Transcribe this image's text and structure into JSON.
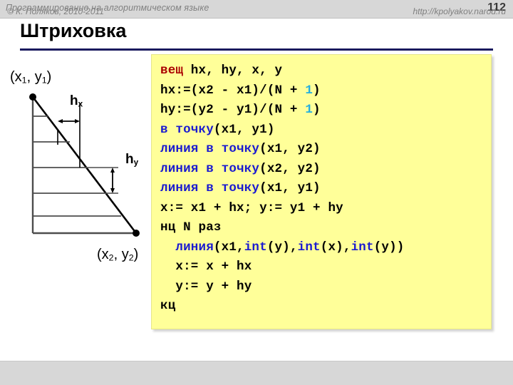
{
  "header": {
    "subject": "Программирование на алгоритмическом языке",
    "page_number": "112"
  },
  "title": "Штриховка",
  "colors": {
    "rule": "#1a1a5e",
    "code_background": "#ffff99",
    "keyword_red": "#aa0000",
    "keyword_blue": "#1a1ad0",
    "number_cyan": "#22aee0",
    "header_background": "#d7d7d7"
  },
  "diagram": {
    "point_top_label": "(x1, y1)",
    "point_top_base": "(x",
    "point_top_sub1": "1",
    "point_top_mid": ", y",
    "point_top_sub2": "1",
    "point_top_end": ")",
    "point_bottom_base": "(x",
    "point_bottom_sub1": "2",
    "point_bottom_mid": ", y",
    "point_bottom_sub2": "2",
    "point_bottom_end": ")",
    "point_bottom_label": "(x2, y2)",
    "hx_base": "h",
    "hx_sub": "x",
    "hy_base": "h",
    "hy_sub": "y"
  },
  "code": {
    "lines": [
      [
        {
          "t": "вещ",
          "c": "red"
        },
        {
          "t": " hx, hy, x, y",
          "c": "plain"
        }
      ],
      [
        {
          "t": "hx:=(x2 - x1)/(N + ",
          "c": "plain"
        },
        {
          "t": "1",
          "c": "cyan"
        },
        {
          "t": ")",
          "c": "plain"
        }
      ],
      [
        {
          "t": "hy:=(y2 - y1)/(N + ",
          "c": "plain"
        },
        {
          "t": "1",
          "c": "cyan"
        },
        {
          "t": ")",
          "c": "plain"
        }
      ],
      [
        {
          "t": "в точку",
          "c": "blue"
        },
        {
          "t": "(x1, y1)",
          "c": "plain"
        }
      ],
      [
        {
          "t": "линия в точку",
          "c": "blue"
        },
        {
          "t": "(x1, y2)",
          "c": "plain"
        }
      ],
      [
        {
          "t": "линия в точку",
          "c": "blue"
        },
        {
          "t": "(x2, y2)",
          "c": "plain"
        }
      ],
      [
        {
          "t": "линия в точку",
          "c": "blue"
        },
        {
          "t": "(x1, y1)",
          "c": "plain"
        }
      ],
      [
        {
          "t": "x:= x1 + hx; y:= y1 + hy",
          "c": "plain"
        }
      ],
      [
        {
          "t": "нц N раз",
          "c": "plain"
        }
      ],
      [
        {
          "t": "  ",
          "c": "plain"
        },
        {
          "t": "линия",
          "c": "blue"
        },
        {
          "t": "(x1,",
          "c": "plain"
        },
        {
          "t": "int",
          "c": "blue"
        },
        {
          "t": "(y),",
          "c": "plain"
        },
        {
          "t": "int",
          "c": "blue"
        },
        {
          "t": "(x),",
          "c": "plain"
        },
        {
          "t": "int",
          "c": "blue"
        },
        {
          "t": "(y))",
          "c": "plain"
        }
      ],
      [
        {
          "t": "  x:= x + hx",
          "c": "plain"
        }
      ],
      [
        {
          "t": "  y:= y + hy",
          "c": "plain"
        }
      ],
      [
        {
          "t": "кц",
          "c": "plain"
        }
      ]
    ]
  },
  "footer": {
    "copyright": "© К. Поляков, 2010-2011",
    "url": "http://kpolyakov.narod.ru"
  }
}
